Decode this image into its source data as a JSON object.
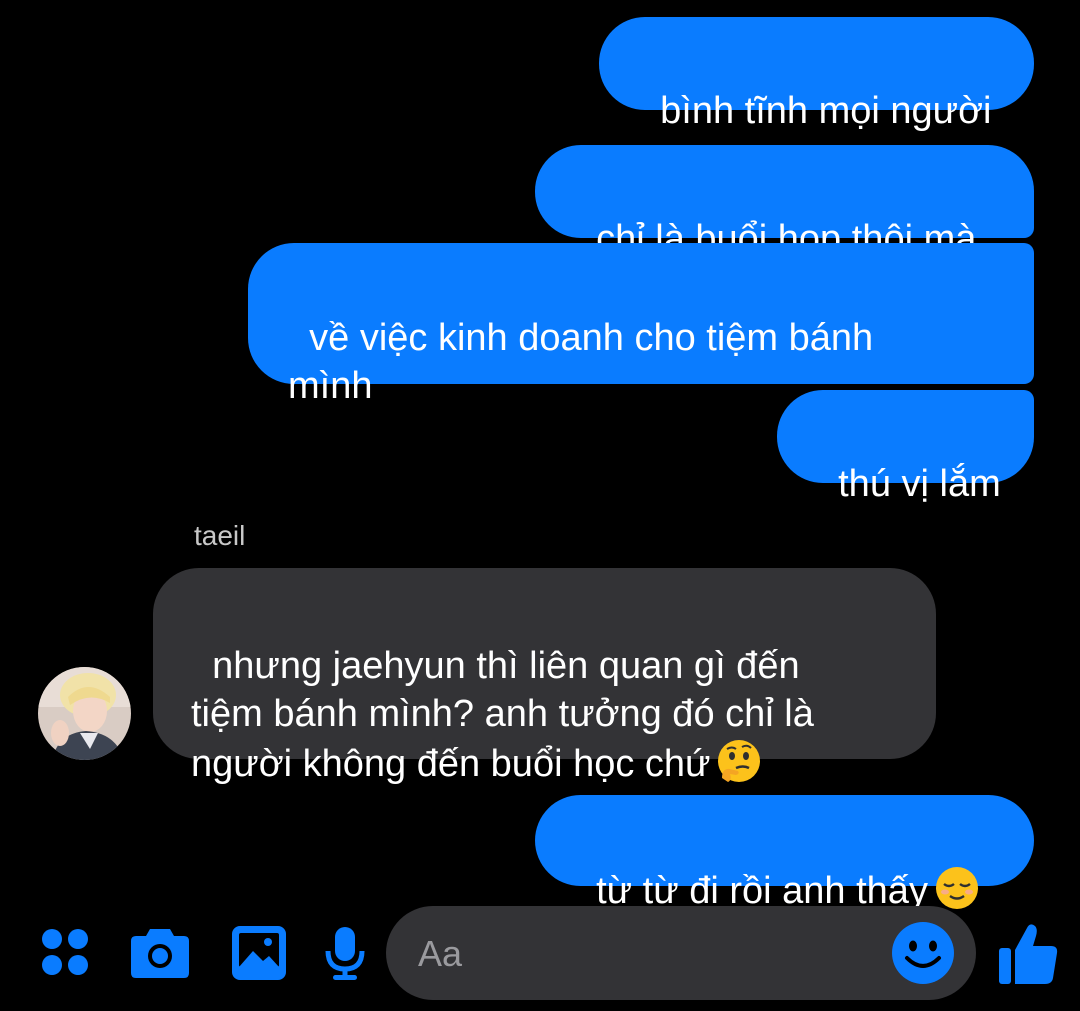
{
  "colors": {
    "accent": "#0a7cff",
    "incoming_bubble": "#333336",
    "background": "#000000"
  },
  "messages": [
    {
      "direction": "outgoing",
      "text": "bình tĩnh mọi người"
    },
    {
      "direction": "outgoing",
      "text": "chỉ là buổi họp thôi mà"
    },
    {
      "direction": "outgoing",
      "text": "về việc kinh doanh cho tiệm bánh\nmình"
    },
    {
      "direction": "outgoing",
      "text": "thú vị lắm"
    },
    {
      "direction": "incoming",
      "sender": "taeil",
      "text": "nhưng jaehyun thì liên quan gì đến\ntiệm bánh mình? anh tưởng đó chỉ là\nngười không đến buổi học chứ",
      "emoji": "thinking-face"
    },
    {
      "direction": "outgoing",
      "text": "từ từ đi rồi anh thấy",
      "emoji": "relieved-face"
    }
  ],
  "composer": {
    "placeholder": "Aa"
  },
  "toolbar": {
    "icons": [
      "apps-icon",
      "camera-icon",
      "gallery-icon",
      "microphone-icon",
      "emoji-icon",
      "like-icon"
    ]
  }
}
